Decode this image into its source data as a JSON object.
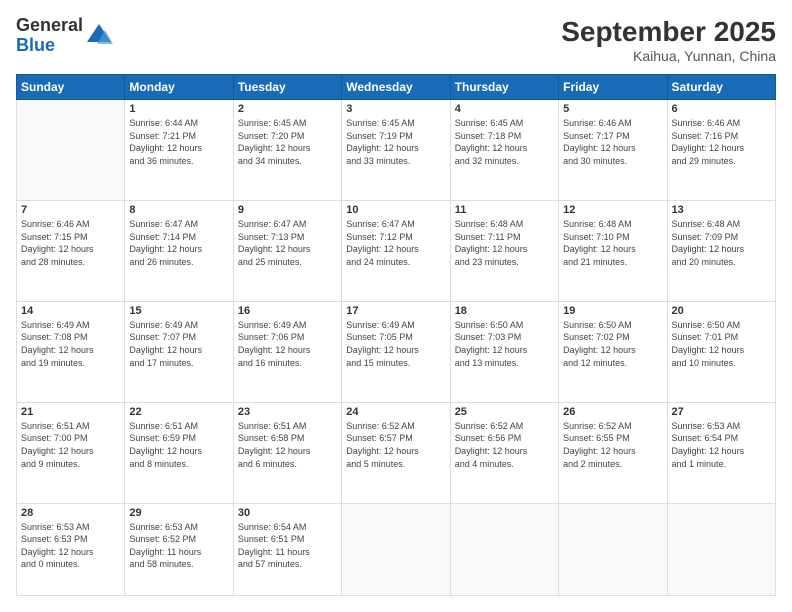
{
  "logo": {
    "line1": "General",
    "line2": "Blue"
  },
  "title": "September 2025",
  "subtitle": "Kaihua, Yunnan, China",
  "weekdays": [
    "Sunday",
    "Monday",
    "Tuesday",
    "Wednesday",
    "Thursday",
    "Friday",
    "Saturday"
  ],
  "weeks": [
    [
      {
        "day": "",
        "info": ""
      },
      {
        "day": "1",
        "info": "Sunrise: 6:44 AM\nSunset: 7:21 PM\nDaylight: 12 hours\nand 36 minutes."
      },
      {
        "day": "2",
        "info": "Sunrise: 6:45 AM\nSunset: 7:20 PM\nDaylight: 12 hours\nand 34 minutes."
      },
      {
        "day": "3",
        "info": "Sunrise: 6:45 AM\nSunset: 7:19 PM\nDaylight: 12 hours\nand 33 minutes."
      },
      {
        "day": "4",
        "info": "Sunrise: 6:45 AM\nSunset: 7:18 PM\nDaylight: 12 hours\nand 32 minutes."
      },
      {
        "day": "5",
        "info": "Sunrise: 6:46 AM\nSunset: 7:17 PM\nDaylight: 12 hours\nand 30 minutes."
      },
      {
        "day": "6",
        "info": "Sunrise: 6:46 AM\nSunset: 7:16 PM\nDaylight: 12 hours\nand 29 minutes."
      }
    ],
    [
      {
        "day": "7",
        "info": "Sunrise: 6:46 AM\nSunset: 7:15 PM\nDaylight: 12 hours\nand 28 minutes."
      },
      {
        "day": "8",
        "info": "Sunrise: 6:47 AM\nSunset: 7:14 PM\nDaylight: 12 hours\nand 26 minutes."
      },
      {
        "day": "9",
        "info": "Sunrise: 6:47 AM\nSunset: 7:13 PM\nDaylight: 12 hours\nand 25 minutes."
      },
      {
        "day": "10",
        "info": "Sunrise: 6:47 AM\nSunset: 7:12 PM\nDaylight: 12 hours\nand 24 minutes."
      },
      {
        "day": "11",
        "info": "Sunrise: 6:48 AM\nSunset: 7:11 PM\nDaylight: 12 hours\nand 23 minutes."
      },
      {
        "day": "12",
        "info": "Sunrise: 6:48 AM\nSunset: 7:10 PM\nDaylight: 12 hours\nand 21 minutes."
      },
      {
        "day": "13",
        "info": "Sunrise: 6:48 AM\nSunset: 7:09 PM\nDaylight: 12 hours\nand 20 minutes."
      }
    ],
    [
      {
        "day": "14",
        "info": "Sunrise: 6:49 AM\nSunset: 7:08 PM\nDaylight: 12 hours\nand 19 minutes."
      },
      {
        "day": "15",
        "info": "Sunrise: 6:49 AM\nSunset: 7:07 PM\nDaylight: 12 hours\nand 17 minutes."
      },
      {
        "day": "16",
        "info": "Sunrise: 6:49 AM\nSunset: 7:06 PM\nDaylight: 12 hours\nand 16 minutes."
      },
      {
        "day": "17",
        "info": "Sunrise: 6:49 AM\nSunset: 7:05 PM\nDaylight: 12 hours\nand 15 minutes."
      },
      {
        "day": "18",
        "info": "Sunrise: 6:50 AM\nSunset: 7:03 PM\nDaylight: 12 hours\nand 13 minutes."
      },
      {
        "day": "19",
        "info": "Sunrise: 6:50 AM\nSunset: 7:02 PM\nDaylight: 12 hours\nand 12 minutes."
      },
      {
        "day": "20",
        "info": "Sunrise: 6:50 AM\nSunset: 7:01 PM\nDaylight: 12 hours\nand 10 minutes."
      }
    ],
    [
      {
        "day": "21",
        "info": "Sunrise: 6:51 AM\nSunset: 7:00 PM\nDaylight: 12 hours\nand 9 minutes."
      },
      {
        "day": "22",
        "info": "Sunrise: 6:51 AM\nSunset: 6:59 PM\nDaylight: 12 hours\nand 8 minutes."
      },
      {
        "day": "23",
        "info": "Sunrise: 6:51 AM\nSunset: 6:58 PM\nDaylight: 12 hours\nand 6 minutes."
      },
      {
        "day": "24",
        "info": "Sunrise: 6:52 AM\nSunset: 6:57 PM\nDaylight: 12 hours\nand 5 minutes."
      },
      {
        "day": "25",
        "info": "Sunrise: 6:52 AM\nSunset: 6:56 PM\nDaylight: 12 hours\nand 4 minutes."
      },
      {
        "day": "26",
        "info": "Sunrise: 6:52 AM\nSunset: 6:55 PM\nDaylight: 12 hours\nand 2 minutes."
      },
      {
        "day": "27",
        "info": "Sunrise: 6:53 AM\nSunset: 6:54 PM\nDaylight: 12 hours\nand 1 minute."
      }
    ],
    [
      {
        "day": "28",
        "info": "Sunrise: 6:53 AM\nSunset: 6:53 PM\nDaylight: 12 hours\nand 0 minutes."
      },
      {
        "day": "29",
        "info": "Sunrise: 6:53 AM\nSunset: 6:52 PM\nDaylight: 11 hours\nand 58 minutes."
      },
      {
        "day": "30",
        "info": "Sunrise: 6:54 AM\nSunset: 6:51 PM\nDaylight: 11 hours\nand 57 minutes."
      },
      {
        "day": "",
        "info": ""
      },
      {
        "day": "",
        "info": ""
      },
      {
        "day": "",
        "info": ""
      },
      {
        "day": "",
        "info": ""
      }
    ]
  ]
}
